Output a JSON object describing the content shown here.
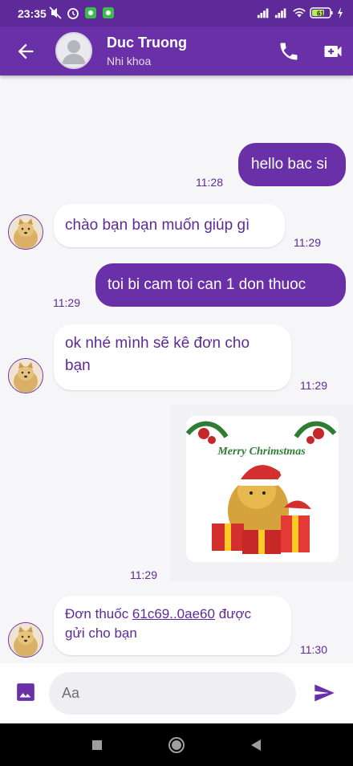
{
  "status_bar": {
    "time": "23:35",
    "battery": "61",
    "icons": [
      "mute-icon",
      "alarm-icon",
      "app-notification-icon",
      "app-notification-icon",
      "signal-icon",
      "signal-icon",
      "wifi-icon",
      "battery-icon",
      "charging-icon"
    ]
  },
  "header": {
    "contact_name": "Duc Truong",
    "subtitle": "Nhi khoa",
    "icons": [
      "back-arrow-icon",
      "avatar-placeholder-icon",
      "phone-icon",
      "video-call-icon"
    ]
  },
  "messages": [
    {
      "direction": "out",
      "text": "hello bac si",
      "time": "11:28"
    },
    {
      "direction": "in",
      "text": "chào bạn bạn muốn giúp gì",
      "time": "11:29"
    },
    {
      "direction": "out",
      "text": "toi bi cam toi can 1 don thuoc",
      "time": "11:29"
    },
    {
      "direction": "in",
      "text_line1": "ok nhé mình sẽ kê đơn cho",
      "text_line2": "bạn",
      "time": "11:29"
    },
    {
      "direction": "in",
      "type": "sticker",
      "sticker_text": "Merry Chrimstmas",
      "time": "11:29"
    },
    {
      "direction": "in",
      "prefix": "Đơn thuốc ",
      "link": "61c69..0ae60",
      "suffix": " được",
      "line2": "gửi cho bạn",
      "time": "11:30"
    }
  ],
  "composer": {
    "placeholder": "Aa",
    "icons": [
      "image-icon",
      "send-icon"
    ]
  },
  "colors": {
    "primary": "#6a30a8",
    "status_bar": "#5e2a99",
    "background": "#f6f5f7",
    "incoming_bubble": "#ffffff",
    "incoming_text": "#5e2a99"
  }
}
